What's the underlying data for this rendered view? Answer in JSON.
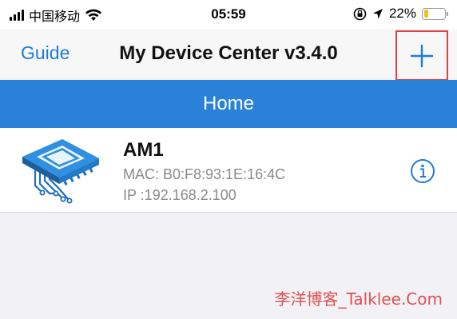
{
  "status_bar": {
    "carrier": "中国移动",
    "time": "05:59",
    "battery": "22%",
    "battery_level": 0.22,
    "icons": [
      "signal-icon",
      "wifi-icon",
      "orientation-lock-icon",
      "location-icon",
      "battery-icon"
    ]
  },
  "nav": {
    "left_button": "Guide",
    "title": "My Device Center v3.4.0",
    "right_icon": "plus-icon"
  },
  "banner": {
    "title": "Home"
  },
  "devices": [
    {
      "name": "AM1",
      "mac": "MAC: B0:F8:93:1E:16:4C",
      "ip": "IP :192.168.2.100",
      "icon": "chip-device-icon",
      "action_icon": "info-icon"
    }
  ],
  "watermark": "李洋博客_Talklee.Com",
  "colors": {
    "accent": "#2a82d8",
    "link": "#1e7cd6",
    "highlight_border": "#e04040",
    "battery": "#f0c21d"
  }
}
